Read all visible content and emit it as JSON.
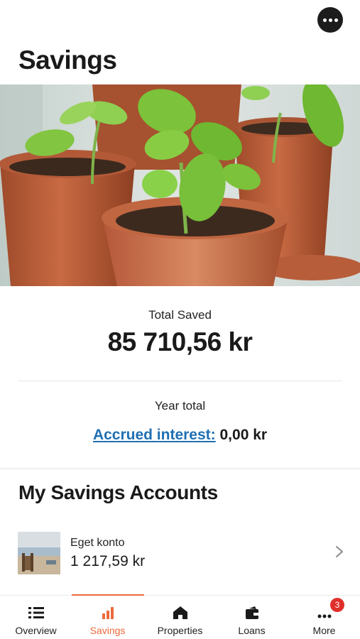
{
  "header": {
    "title": "Savings",
    "more_icon": "ellipsis-icon"
  },
  "hero": {
    "image": "potted-seedlings-image"
  },
  "summary": {
    "total_label": "Total Saved",
    "total_value": "85 710,56 kr",
    "year_label": "Year total",
    "interest_link_label": "Accrued interest:",
    "interest_value": "0,00 kr"
  },
  "accounts_section": {
    "title": "My Savings Accounts",
    "accounts": [
      {
        "name": "Eget konto",
        "balance": "1 217,59 kr",
        "thumbnail": "beach-chair-image"
      }
    ]
  },
  "bottom_nav": {
    "items": [
      {
        "label": "Overview",
        "icon": "list-icon",
        "active": false
      },
      {
        "label": "Savings",
        "icon": "bar-chart-icon",
        "active": true
      },
      {
        "label": "Properties",
        "icon": "house-icon",
        "active": false
      },
      {
        "label": "Loans",
        "icon": "wallet-icon",
        "active": false
      },
      {
        "label": "More",
        "icon": "ellipsis-icon",
        "active": false,
        "badge": "3"
      }
    ]
  },
  "colors": {
    "accent": "#ec6a3c",
    "link": "#1f6fb2",
    "badge": "#e0302c",
    "text": "#1a1a1a"
  }
}
